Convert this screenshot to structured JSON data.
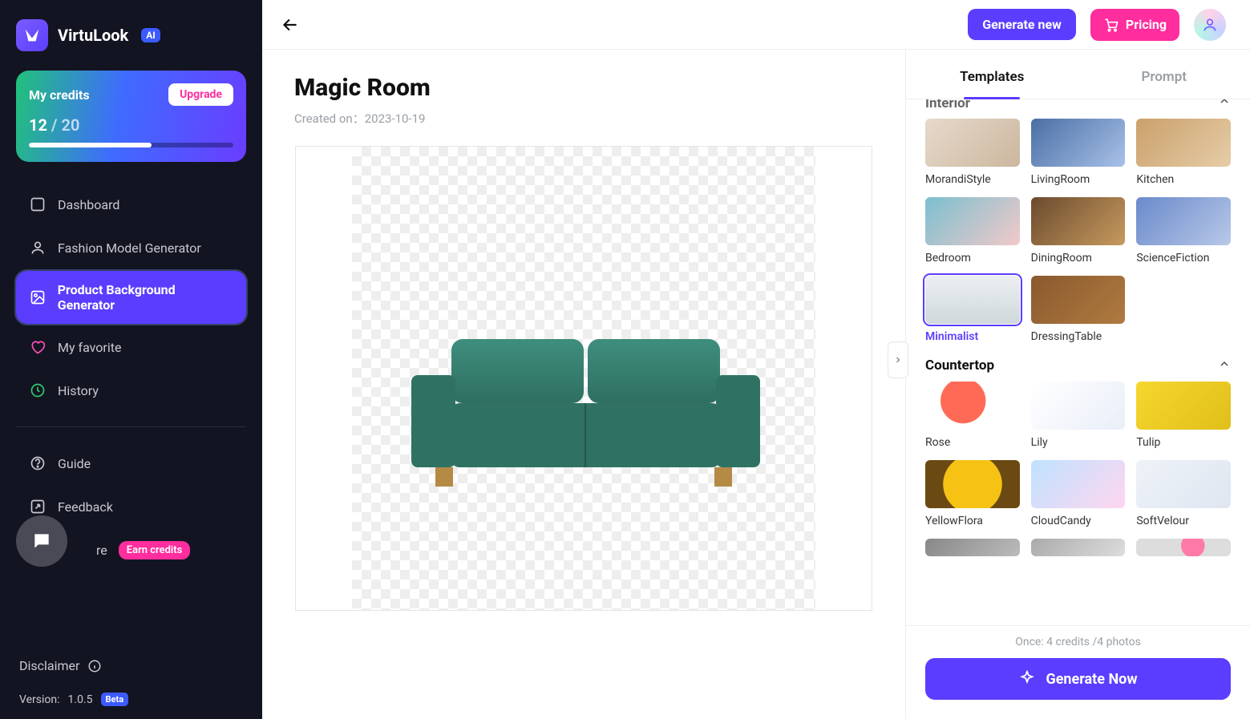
{
  "brand": {
    "name": "VirtuLook",
    "ai": "AI"
  },
  "credits": {
    "title": "My credits",
    "used": "12",
    "sep": " / ",
    "total": "20",
    "upgrade": "Upgrade",
    "percent": 60
  },
  "sidebar": {
    "items": [
      {
        "label": "Dashboard"
      },
      {
        "label": "Fashion Model Generator"
      },
      {
        "label": "Product Background Generator"
      },
      {
        "label": "My favorite"
      },
      {
        "label": "History"
      }
    ],
    "guide": "Guide",
    "feedback": "Feedback",
    "share": "re",
    "earn": "Earn credits",
    "disclaimer": "Disclaimer",
    "version_label": "Version:",
    "version": "1.0.5",
    "beta": "Beta"
  },
  "top": {
    "generate_new": "Generate new",
    "pricing": "Pricing"
  },
  "page": {
    "title": "Magic Room",
    "created_label": "Created on：",
    "created_date": "2023-10-19"
  },
  "tabs": {
    "templates": "Templates",
    "prompt": "Prompt"
  },
  "sections": {
    "interior": {
      "title": "Interior",
      "items": [
        {
          "label": "MorandiStyle",
          "cls": "morandi"
        },
        {
          "label": "LivingRoom",
          "cls": "living"
        },
        {
          "label": "Kitchen",
          "cls": "kitchen"
        },
        {
          "label": "Bedroom",
          "cls": "bedroom"
        },
        {
          "label": "DiningRoom",
          "cls": "dining"
        },
        {
          "label": "ScienceFiction",
          "cls": "sci"
        },
        {
          "label": "Minimalist",
          "cls": "minimal",
          "selected": true
        },
        {
          "label": "DressingTable",
          "cls": "dresser"
        }
      ]
    },
    "countertop": {
      "title": "Countertop",
      "items": [
        {
          "label": "Rose",
          "cls": "rose"
        },
        {
          "label": "Lily",
          "cls": "lily"
        },
        {
          "label": "Tulip",
          "cls": "tulip"
        },
        {
          "label": "YellowFlora",
          "cls": "sunflower"
        },
        {
          "label": "CloudCandy",
          "cls": "cloud"
        },
        {
          "label": "SoftVelour",
          "cls": "velour"
        }
      ]
    }
  },
  "cost": {
    "text": "Once: 4 credits /4 photos"
  },
  "generate_now": "Generate Now"
}
